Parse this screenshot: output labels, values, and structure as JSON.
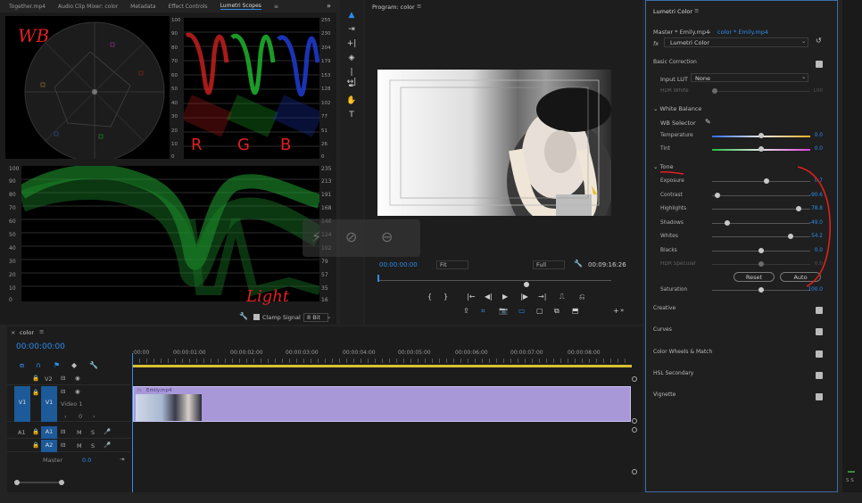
{
  "scope_tabs": [
    "Together.mp4",
    "Audio Clip Mixer: color",
    "Metadata",
    "Effect Controls",
    "Lumetri Scopes"
  ],
  "rgb_scale": [
    "100",
    "90",
    "80",
    "70",
    "60",
    "50",
    "40",
    "30",
    "20",
    "10",
    "0"
  ],
  "rgb_scale_right": [
    "255",
    "230",
    "204",
    "179",
    "153",
    "128",
    "102",
    "77",
    "51",
    "26",
    "0"
  ],
  "wave_scale": [
    "100",
    "90",
    "80",
    "70",
    "60",
    "50",
    "40",
    "30",
    "20",
    "10",
    "0"
  ],
  "wave_scale_right": [
    "235",
    "213",
    "191",
    "168",
    "146",
    "124",
    "102",
    "79",
    "57",
    "35",
    "16"
  ],
  "scopes_footer": {
    "clamp": "Clamp Signal",
    "bit": "8 Bit"
  },
  "annotations": {
    "wb": "WB",
    "r": "R",
    "g": "G",
    "b": "B",
    "light": "Light"
  },
  "program": {
    "title": "Program: color",
    "timecode": "00:00:00:00",
    "fit": "Fit",
    "full": "Full",
    "duration": "00:09:16:26"
  },
  "lumetri": {
    "title": "Lumetri Color",
    "master": "Master * Emily.mp4",
    "clip": "color * Emily.mp4",
    "fx": "fx",
    "effect": "Lumetri Color",
    "basic": "Basic Correction",
    "input_lut_label": "Input LUT",
    "input_lut_value": "None",
    "hdr_white": "HDR White",
    "hdr_white_val": "100",
    "white_balance": "White Balance",
    "wb_selector": "WB Selector",
    "tone": "Tone",
    "reset": "Reset",
    "auto": "Auto",
    "sections": [
      "Creative",
      "Curves",
      "Color Wheels & Match",
      "HSL Secondary",
      "Vignette"
    ]
  },
  "sliders_wb": [
    {
      "label": "Temperature",
      "value": "0.0",
      "pos": 0.5
    },
    {
      "label": "Tint",
      "value": "0.0",
      "pos": 0.5
    }
  ],
  "sliders_tone": [
    {
      "label": "Exposure",
      "value": "0.7",
      "pos": 0.55
    },
    {
      "label": "Contrast",
      "value": "-90.6",
      "pos": 0.05
    },
    {
      "label": "Highlights",
      "value": "78.8",
      "pos": 0.88
    },
    {
      "label": "Shadows",
      "value": "-49.0",
      "pos": 0.15
    },
    {
      "label": "Whites",
      "value": "54.2",
      "pos": 0.8
    },
    {
      "label": "Blacks",
      "value": "0.0",
      "pos": 0.5
    },
    {
      "label": "HDR Specular",
      "value": "0.0",
      "pos": 0.5
    }
  ],
  "saturation": {
    "label": "Saturation",
    "value": "100.0",
    "pos": 0.5
  },
  "timeline": {
    "title": "color",
    "timecode": "00:00:00:00",
    "ruler": [
      ":00:00",
      "00:00:01:00",
      "00:00:02:00",
      "00:00:03:00",
      "00:00:04:00",
      "00:00:05:00",
      "00:00:06:00",
      "00:00:07:00",
      "00:00:08:00"
    ],
    "v2": "V2",
    "v1": "V1",
    "a1": "A1",
    "a2": "A2",
    "video1": "Video 1",
    "clip": "Emily.mp4",
    "master": "Master",
    "master_val": "0.0",
    "m": "M",
    "s": "S",
    "zero": "0",
    "fx_badge": "fx"
  },
  "meter_label": "S S"
}
